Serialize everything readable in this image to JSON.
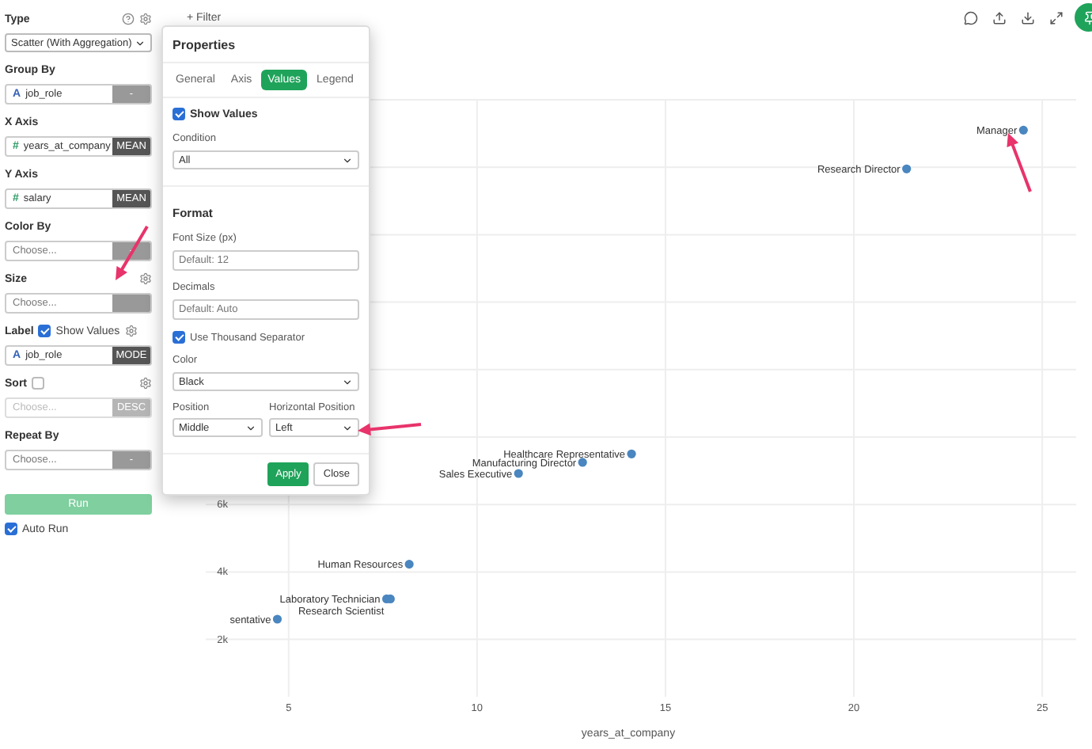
{
  "sidebar": {
    "type": {
      "label": "Type",
      "value": "Scatter (With Aggregation)"
    },
    "fields": [
      {
        "label": "Group By",
        "type_mark": "A",
        "value": "job_role",
        "agg": {
          "label": "-",
          "color": "#999999"
        }
      },
      {
        "label": "X Axis",
        "type_mark": "#",
        "value": "years_at_company",
        "agg": {
          "label": "MEAN",
          "color": "#555555"
        }
      },
      {
        "label": "Y Axis",
        "type_mark": "#",
        "value": "salary",
        "agg": {
          "label": "MEAN",
          "color": "#555555"
        }
      },
      {
        "label": "Color By",
        "placeholder": "Choose...",
        "agg": {
          "label": "-",
          "color": "#999999"
        }
      },
      {
        "label": "Size",
        "placeholder": "Choose...",
        "agg": {
          "color": "#999999"
        },
        "gear": true
      },
      {
        "label": "Label",
        "checkbox": {
          "checked": true,
          "label": "Show Values"
        },
        "gear": true,
        "type_mark": "A",
        "value": "job_role",
        "agg": {
          "label": "MODE",
          "color": "#555555"
        }
      },
      {
        "label": "Sort",
        "checkbox": {
          "checked": false
        },
        "gear": true,
        "placeholder": "Choose...",
        "agg": {
          "label": "DESC",
          "color": "#b5b5b5"
        },
        "disabled": true
      },
      {
        "label": "Repeat By",
        "placeholder": "Choose...",
        "agg": {
          "label": "-",
          "color": "#999999"
        }
      }
    ],
    "run_button": "Run",
    "auto_run": {
      "label": "Auto Run",
      "checked": true
    }
  },
  "toolbar": {
    "filter_button": "+ Filter"
  },
  "properties": {
    "title": "Properties",
    "tabs": [
      {
        "label": "General",
        "selected": false
      },
      {
        "label": "Axis",
        "selected": false
      },
      {
        "label": "Values",
        "selected": true
      },
      {
        "label": "Legend",
        "selected": false
      }
    ],
    "show_values": {
      "label": "Show Values",
      "checked": true
    },
    "condition": {
      "label": "Condition",
      "value": "All"
    },
    "format_heading": "Format",
    "font_size": {
      "label": "Font Size (px)",
      "placeholder": "Default: 12"
    },
    "decimals": {
      "label": "Decimals",
      "placeholder": "Default: Auto"
    },
    "thousand_separator": {
      "label": "Use Thousand Separator",
      "checked": true
    },
    "color": {
      "label": "Color",
      "value": "Black"
    },
    "position": {
      "label": "Position",
      "value": "Middle"
    },
    "horizontal_position": {
      "label": "Horizontal Position",
      "value": "Left"
    },
    "apply_button": "Apply",
    "close_button": "Close"
  },
  "chart": {
    "chart_data": {
      "type": "scatter",
      "xlabel": "years_at_company",
      "xlim": [
        2.8,
        25.9
      ],
      "ylim": [
        300,
        18000
      ],
      "grid": true,
      "xticks": [
        5,
        10,
        15,
        20,
        25
      ],
      "yticks": [
        {
          "value": 2000,
          "label": "2k"
        },
        {
          "value": 4000,
          "label": "4k"
        },
        {
          "value": 6000,
          "label": "6k"
        }
      ],
      "x": [
        24.5,
        21.4,
        14.1,
        12.8,
        11.1,
        8.2,
        7.6,
        7.7,
        4.7
      ],
      "series": [
        {
          "color": "#4a86bf",
          "values": [
            17100,
            15950,
            7500,
            7250,
            6920,
            4230,
            3200,
            3200,
            2600
          ]
        }
      ],
      "annotations": [
        "Manager",
        "Research Director",
        "Healthcare Representative",
        "Manufacturing Director",
        "Sales Executive",
        "Human Resources",
        "Laboratory Technician",
        "Research Scientist",
        "sentative"
      ]
    }
  }
}
